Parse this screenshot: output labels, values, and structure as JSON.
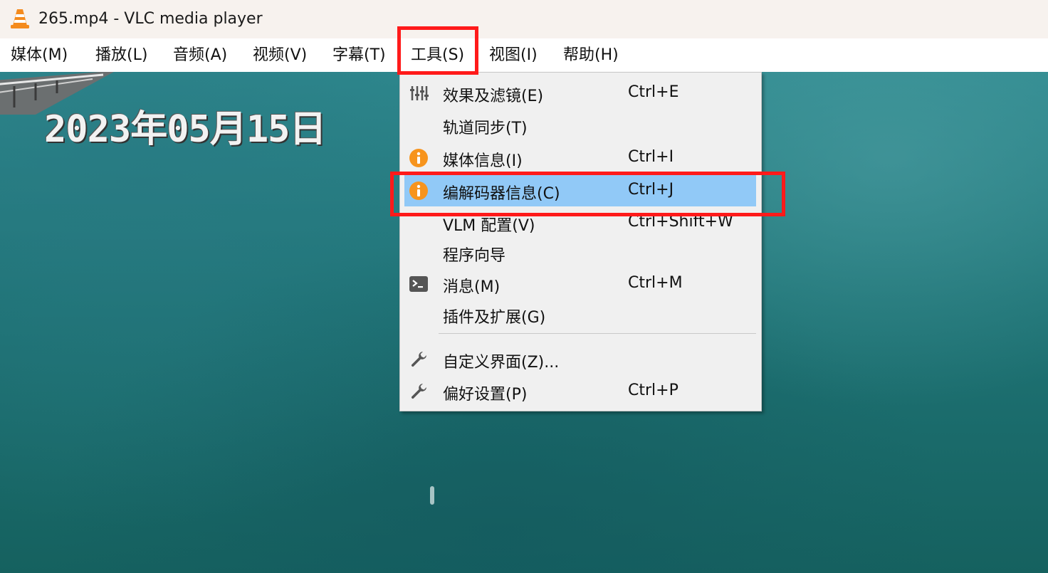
{
  "window": {
    "title": "265.mp4 - VLC media player"
  },
  "menubar": {
    "items": [
      {
        "label": "媒体(M)"
      },
      {
        "label": "播放(L)"
      },
      {
        "label": "音频(A)"
      },
      {
        "label": "视频(V)"
      },
      {
        "label": "字幕(T)"
      },
      {
        "label": "工具(S)"
      },
      {
        "label": "视图(I)"
      },
      {
        "label": "帮助(H)"
      }
    ]
  },
  "video": {
    "overlay_text": "2023年05月15日"
  },
  "tools_menu": {
    "items": [
      {
        "label": "效果及滤镜(E)",
        "shortcut": "Ctrl+E",
        "icon": "equalizer-icon"
      },
      {
        "label": "轨道同步(T)",
        "shortcut": "",
        "icon": ""
      },
      {
        "label": "媒体信息(I)",
        "shortcut": "Ctrl+I",
        "icon": "info-icon"
      },
      {
        "label": "编解码器信息(C)",
        "shortcut": "Ctrl+J",
        "icon": "info-icon"
      },
      {
        "label": "VLM 配置(V)",
        "shortcut": "Ctrl+Shift+W",
        "icon": ""
      },
      {
        "label": "程序向导",
        "shortcut": "",
        "icon": ""
      },
      {
        "label": "消息(M)",
        "shortcut": "Ctrl+M",
        "icon": "terminal-icon"
      },
      {
        "label": "插件及扩展(G)",
        "shortcut": "",
        "icon": ""
      },
      {
        "label": "自定义界面(Z)...",
        "shortcut": "",
        "icon": "wrench-icon"
      },
      {
        "label": "偏好设置(P)",
        "shortcut": "Ctrl+P",
        "icon": "wrench-icon"
      }
    ]
  },
  "colors": {
    "highlight": "#91c9f7",
    "annotation_red": "#ff1a1a",
    "info_orange": "#f7941d"
  }
}
